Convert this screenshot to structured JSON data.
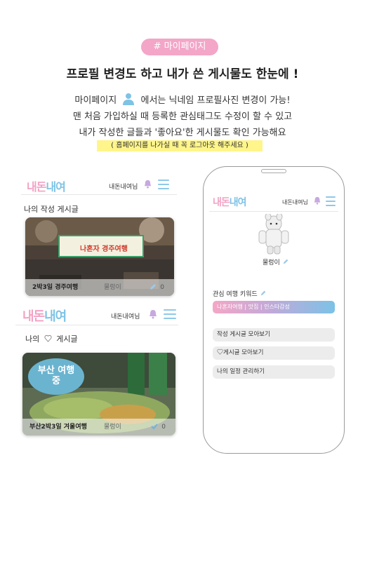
{
  "tag": "# 마이페이지",
  "headline": "프로필 변경도 하고 내가 쓴 게시물도 한눈에 !",
  "desc": {
    "line1_pre": "마이페이지",
    "line1_post": "에서는 닉네임 프로필사진 변경이 가능!",
    "line2": "맨 처음 가입하실 때 등록한 관심태그도 수정이 할 수 있고",
    "line3": "내가 작성한 글들과 '좋아요'한 게시물도 확인 가능해요"
  },
  "note": "( 홈페이지를 나가실 때 꼭 로그아웃 해주세요 )",
  "brand": {
    "part1": "내돈",
    "part2": "내여"
  },
  "username": "내돈내여님",
  "panel_written": {
    "title": "나의 작성 게시글",
    "banner": "나혼자 경주여행",
    "card": {
      "title": "2박3일 경주여행",
      "user": "물렁이",
      "count": "0"
    }
  },
  "panel_liked": {
    "title_pre": "나의",
    "title_post": "게시글",
    "sign": "부산 여행중",
    "card": {
      "title": "부산2박3일 겨울여행",
      "user": "물렁이",
      "count": "0"
    }
  },
  "phone": {
    "nickname": "물렁이",
    "keyword_title": "관심 여행 키워드",
    "keywords": "나혼자여행 | 맛집 | 인스타감성",
    "menu": [
      "작성 게시글 모아보기",
      "게시글 모아보기",
      "나의 일정 관리하기"
    ]
  },
  "colors": {
    "pink": "#f3a6c8",
    "blue": "#7ec3e6",
    "highlight": "#fff58a"
  }
}
